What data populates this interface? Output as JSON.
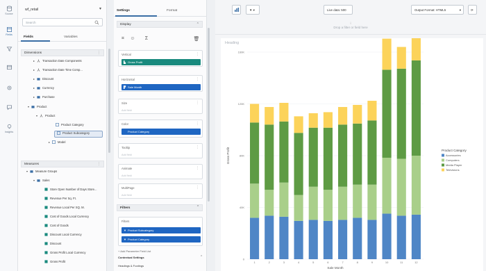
{
  "rail": {
    "items": [
      {
        "label": "Source",
        "icon": "database-icon"
      },
      {
        "label": "Fields",
        "icon": "fields-icon"
      },
      {
        "label": "",
        "icon": "filter-icon"
      },
      {
        "label": "",
        "icon": "calendar-icon"
      },
      {
        "label": "",
        "icon": "gear-icon"
      },
      {
        "label": "",
        "icon": "comment-icon"
      },
      {
        "label": "Insights",
        "icon": "lightbulb-icon"
      }
    ]
  },
  "fields_panel": {
    "datasource": "wf_retail",
    "search_placeholder": "Search",
    "tabs": [
      "Fields",
      "Variables"
    ],
    "dimensions_label": "Dimensions",
    "dimensions": [
      {
        "label": "Transaction Date Components"
      },
      {
        "label": "Transaction Date Time Comp..."
      },
      {
        "label": "Discount"
      },
      {
        "label": "Currency"
      },
      {
        "label": "Purchase"
      },
      {
        "label": "Product"
      },
      {
        "label": "Product"
      },
      {
        "label": "Product Category"
      },
      {
        "label": "Product Subcategory"
      },
      {
        "label": "Model"
      }
    ],
    "measures_label": "Measures",
    "measures": [
      {
        "label": "Measure Groups"
      },
      {
        "label": "Sales"
      },
      {
        "label": "Store Open Number of Days Store..."
      },
      {
        "label": "Revenue Per Sq. Ft."
      },
      {
        "label": "Revenue Local Per SQ. M."
      },
      {
        "label": "Cost of Goods Local Currency"
      },
      {
        "label": "Cost of Goods"
      },
      {
        "label": "Discount Local Currency"
      },
      {
        "label": "Discount"
      },
      {
        "label": "Gross Profit Local Currency"
      },
      {
        "label": "Gross Profit"
      }
    ]
  },
  "settings": {
    "tabs": [
      "Settings",
      "Format"
    ],
    "display_label": "Display",
    "wells": [
      {
        "label": "Vertical",
        "value": "Gross Profit",
        "color": "#198a7e"
      },
      {
        "label": "Horizontal",
        "value": "Sale Month",
        "color": "#1f66c2"
      },
      {
        "label": "Size",
        "placeholder": "Add field"
      },
      {
        "label": "Color",
        "value": "Product Category",
        "color": "#1f66c2"
      },
      {
        "label": "Tooltip",
        "placeholder": "Add field"
      },
      {
        "label": "Animate",
        "placeholder": "Add field"
      },
      {
        "label": "MultiPage",
        "placeholder": "Add field"
      }
    ],
    "filters_label": "Filters",
    "filters_well_label": "Filters",
    "filters": [
      "Product Subcategory",
      "Product Category"
    ],
    "add_param_text": "+ Add Parameter Field List",
    "contextual_label": "Contextual Settings",
    "headings_label": "Headings & Footings"
  },
  "toolbar": {
    "live_data": "Live data: 500",
    "output_format": "Output Format: HTML5"
  },
  "canvas": {
    "drop_hint": "Drop a filter or field here"
  },
  "chart_data": {
    "type": "bar",
    "stacked": true,
    "title": "Heading",
    "xlabel": "Sale Month",
    "ylabel": "Gross Profit",
    "categories": [
      "1",
      "2",
      "3",
      "4",
      "5",
      "6",
      "7",
      "8",
      "9",
      "10",
      "11",
      "12"
    ],
    "ylim": [
      0,
      2000
    ],
    "ytick_values": [
      0,
      500,
      1000,
      1500,
      2000
    ],
    "ytick_labels": [
      "0",
      "40K",
      "80K",
      "120K",
      "160K"
    ],
    "legend_title": "Product Category",
    "legend_position": "right",
    "series": [
      {
        "name": "Accessories",
        "color": "#4f86c6",
        "values": [
          400,
          420,
          410,
          370,
          380,
          370,
          380,
          400,
          380,
          440,
          420,
          430
        ]
      },
      {
        "name": "Computers",
        "color": "#a9cf8a",
        "values": [
          330,
          250,
          330,
          250,
          320,
          300,
          320,
          320,
          340,
          540,
          550,
          570
        ]
      },
      {
        "name": "Media Player",
        "color": "#5e9b44",
        "values": [
          590,
          630,
          590,
          600,
          570,
          600,
          600,
          590,
          620,
          850,
          870,
          920
        ]
      },
      {
        "name": "Televisions",
        "color": "#fcd35a",
        "values": [
          180,
          170,
          180,
          160,
          140,
          150,
          170,
          180,
          190,
          300,
          210,
          270
        ]
      }
    ]
  }
}
